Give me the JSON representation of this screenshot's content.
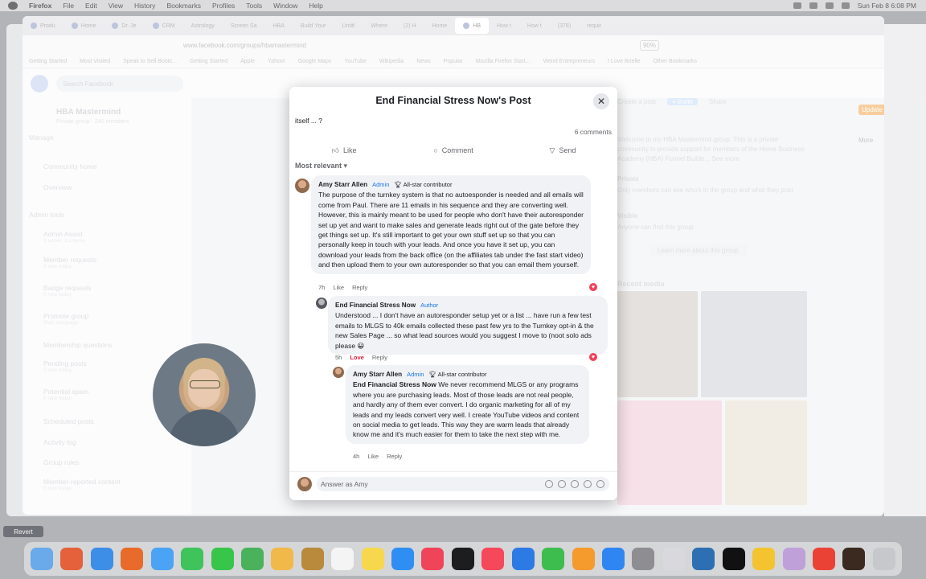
{
  "menubar": {
    "app": "Firefox",
    "items": [
      "File",
      "Edit",
      "View",
      "History",
      "Bookmarks",
      "Profiles",
      "Tools",
      "Window",
      "Help"
    ],
    "datetime": "Sun Feb 8  6:08 PM"
  },
  "browser": {
    "tabs": [
      "Produ",
      "Home",
      "Dr. Je",
      "CRM",
      "Astrology",
      "Screen Sa",
      "HBA",
      "Build Your",
      "Untitl",
      "Where",
      "(2) H",
      "Home",
      "HB",
      "How t",
      "How t",
      "(378)",
      "requir"
    ],
    "active_tab": "HB",
    "url": "www.facebook.com/groups/hbamastermind",
    "zoom": "90%",
    "bookmarks": [
      "Getting Started",
      "Most Visited",
      "Speak to Sell Bootc...",
      "Getting Started",
      "Apple",
      "Yahoo!",
      "Google Maps",
      "YouTube",
      "Wikipedia",
      "News",
      "Popular",
      "Mozilla Firefox Start...",
      "Weird Entrepreneurs",
      "I Love Brielle",
      "Other Bookmarks"
    ]
  },
  "facebook": {
    "search_placeholder": "Search Facebook",
    "group_name": "HBA Mastermind",
    "group_meta": "Private group · 240 members",
    "manage": "Manage",
    "sidebar": [
      {
        "label": "Community home",
        "sub": ""
      },
      {
        "label": "Overview",
        "sub": ""
      },
      {
        "label": "Admin tools",
        "sub": ""
      },
      {
        "label": "Admin Assist",
        "sub": "1 active, 1 criteria"
      },
      {
        "label": "Member requests",
        "sub": "0 new today"
      },
      {
        "label": "Badge requests",
        "sub": "0 new today"
      },
      {
        "label": "Promote group",
        "sub": "Start campaign"
      },
      {
        "label": "Membership questions",
        "sub": ""
      },
      {
        "label": "Pending posts",
        "sub": "0 new today"
      },
      {
        "label": "Potential spam",
        "sub": "0 new today"
      },
      {
        "label": "Scheduled posts",
        "sub": ""
      },
      {
        "label": "Activity log",
        "sub": ""
      },
      {
        "label": "Group rules",
        "sub": ""
      },
      {
        "label": "Member-reported content",
        "sub": "0 new today"
      }
    ],
    "right_about": "Welcome to my HBA Mastermind group. This is a private community to provide support for members of the Home Business Academy (HBA) Funnel Builde... See more",
    "right_private": "Private",
    "right_private_desc": "Only members can see who's in the group and what they post.",
    "right_visible": "Visible",
    "right_visible_desc": "Anyone can find this group.",
    "right_learn_more": "Learn more about this group",
    "right_media": "Recent media",
    "buttons": {
      "create_post": "Create a post",
      "invite": "+ Invite",
      "share": "Share",
      "update": "Update",
      "more": "More"
    }
  },
  "modal": {
    "title": "End Financial Stress Now's Post",
    "snippet": "itself ... ?",
    "comment_count": "6 comments",
    "actions": {
      "like": "Like",
      "comment": "Comment",
      "send": "Send"
    },
    "sort_label": "Most relevant",
    "comments": [
      {
        "author": "Amy Starr Allen",
        "badge1": "Admin",
        "badge2": "All-star contributor",
        "text": "The purpose of the turnkey system is that no autoesponder is needed and all emails will come from Paul. There are 11 emails in his sequence and they are converting well. However, this is mainly meant to be used for people who don't have their autoresponder set up yet and want to make sales and generate leads right out of the gate before they get things set up. It's still important to get your own stuff set up so that you can personally keep in touch with your leads. And once you have it set up, you can download your leads from the back office (on the affiliates tab under the fast start video) and then upload them to your own autoresponder so that you can email them yourself.",
        "time": "7h",
        "like": "Like",
        "reply": "Reply"
      },
      {
        "author": "End Financial Stress Now",
        "badge1": "Author",
        "text": "Understood ... I don't have an autoresponder setup yet or a list ... have run a few test emails to MLGS to 40k emails collected these past few yrs to the Turnkey opt-in & the new Sales Page ... so what lead sources would you suggest I move to (noot solo ads please 😀",
        "time": "5h",
        "like": "Love",
        "reply": "Reply"
      },
      {
        "author": "Amy Starr Allen",
        "badge1": "Admin",
        "badge2": "All-star contributor",
        "mention": "End Financial Stress Now",
        "text": " We never recommend MLGS or any programs where you are purchasing leads. Most of those leads are not real people, and hardly any of them ever convert. I do organic marketing for all of my leads and my leads convert very well. I create YouTube videos and content on social media to get leads. This way they are warm leads that already know me and it's much easier for them to take the next step with me.",
        "time": "4h",
        "like": "Like",
        "reply": "Reply"
      }
    ],
    "answer_placeholder": "Answer as Amy"
  },
  "overlay": {
    "revert_label": "Revert"
  }
}
